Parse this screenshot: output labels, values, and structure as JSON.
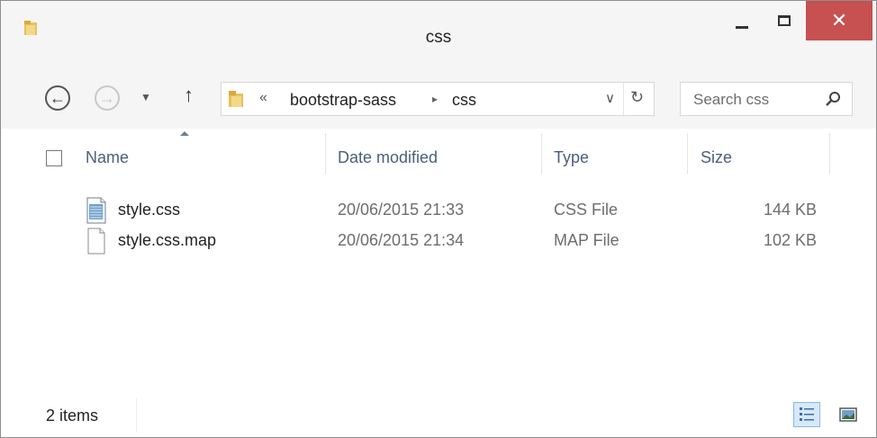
{
  "window": {
    "title": "css"
  },
  "titlebar": {
    "close_symbol": "✕"
  },
  "nav": {
    "back_icon": "back-arrow-icon",
    "forward_icon": "forward-arrow-icon",
    "recent_icon": "chevron-down-icon",
    "up_icon": "up-arrow-icon",
    "address": {
      "chevron": "«",
      "segments": [
        "bootstrap-sass",
        "css"
      ],
      "separator": "▸"
    },
    "refresh_symbol": "↻",
    "dropdown_symbol": "∨"
  },
  "search": {
    "placeholder": "Search css"
  },
  "columns": {
    "name": "Name",
    "date": "Date modified",
    "type": "Type",
    "size": "Size"
  },
  "files": [
    {
      "name": "style.css",
      "date": "20/06/2015 21:33",
      "type": "CSS File",
      "size": "144 KB",
      "icon": "css-file-icon"
    },
    {
      "name": "style.css.map",
      "date": "20/06/2015 21:34",
      "type": "MAP File",
      "size": "102 KB",
      "icon": "generic-file-icon"
    }
  ],
  "status": {
    "item_count": "2 items"
  },
  "colors": {
    "close_red": "#c75050",
    "header_text": "#4c607a",
    "selected_view": "#d7e8f9"
  }
}
